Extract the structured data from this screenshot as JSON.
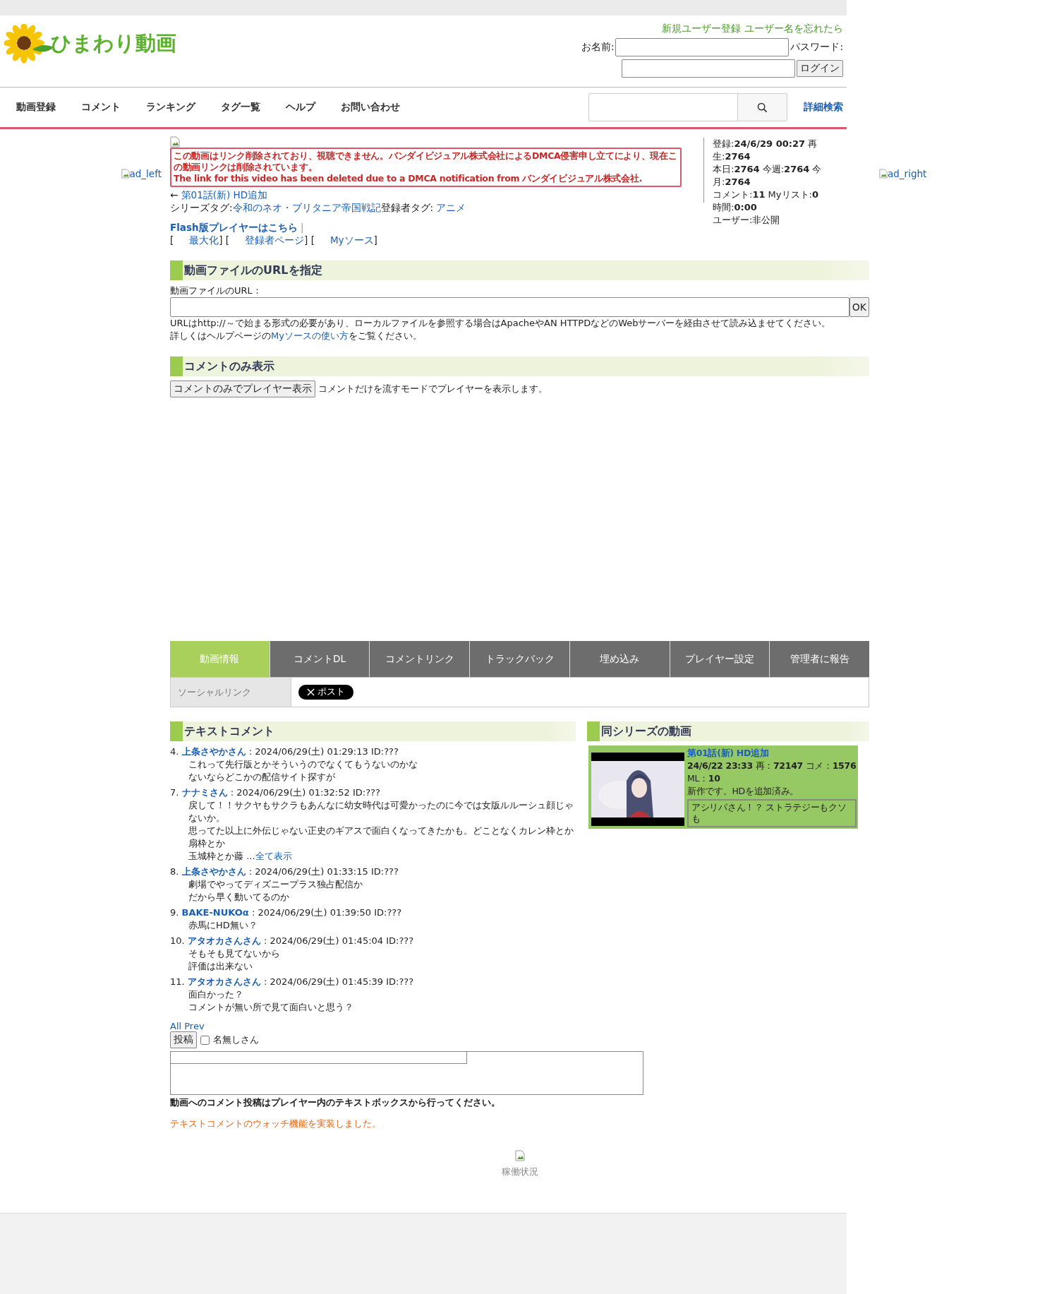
{
  "header": {
    "logo": "ひまわり動画",
    "links": [
      "新規ユーザー登録",
      "ユーザー名を忘れたら"
    ],
    "name_label": "お名前:",
    "password_label": "パスワード:",
    "login_button": "ログイン"
  },
  "nav": {
    "items": [
      "動画登録",
      "コメント",
      "ランキング",
      "タグ一覧",
      "ヘルプ",
      "お問い合わせ"
    ],
    "advanced_search": "詳細検索"
  },
  "ads": {
    "left": "ad_left",
    "right": "ad_right"
  },
  "notice": {
    "lines": [
      "この動画はリンク削除されており、視聴できません。バンダイビジュアル株式会社によるDMCA侵害申し立てにより、現在この動画リンクは削除されています。",
      "The link for this video has been deleted due to a DMCA notification from バンダイビジュアル株式会社."
    ]
  },
  "prev_link": {
    "arrow": "←",
    "title": "第01話(新) HD追加"
  },
  "tags": {
    "series_label": "シリーズタグ:",
    "series": "令和のネオ・ブリタニア帝国戦記",
    "user_label": "登録者タグ:",
    "user": "アニメ"
  },
  "player_links": {
    "flash": "Flash版プレイヤーはこちら",
    "separator": "|",
    "open": "[",
    "middle": "] [",
    "close": "]",
    "items": [
      "最大化",
      "登録者ページ",
      "Myソース"
    ]
  },
  "stats": {
    "lines": [
      [
        {
          "label": "登録:",
          "value": "24/6/29 00:27"
        },
        {
          "label": "再生:",
          "value": "2764"
        }
      ],
      [
        {
          "label": "本日:",
          "value": "2764"
        },
        {
          "label": "今週:",
          "value": "2764"
        },
        {
          "label": "今月:",
          "value": "2764"
        }
      ],
      [
        {
          "label": "コメント:",
          "value": "11"
        },
        {
          "label": "Myリスト:",
          "value": "0"
        }
      ],
      [
        {
          "label": "時間:",
          "value": "0:00"
        }
      ],
      [
        {
          "label": "ユーザー:非公開"
        }
      ]
    ]
  },
  "url_section": {
    "title": "動画ファイルのURLを指定",
    "label": "動画ファイルのURL：",
    "ok_button": "OK",
    "note": "URLはhttp://～で始まる形式の必要があり、ローカルファイルを参照する場合はApacheやAN HTTPDなどのWebサーバーを経由させて読み込ませてください。",
    "help_before": "詳しくはヘルプページの",
    "help_link": "Myソースの使い方",
    "help_after": "をご覧ください。"
  },
  "comment_only": {
    "title": "コメントのみ表示",
    "button": "コメントのみでプレイヤー表示",
    "note": "コメントだけを流すモードでプレイヤーを表示します。"
  },
  "tabs": [
    {
      "label": "動画情報",
      "selected": true
    },
    {
      "label": "コメントDL",
      "selected": false
    },
    {
      "label": "コメントリンク",
      "selected": false
    },
    {
      "label": "トラックバック",
      "selected": false
    },
    {
      "label": "埋め込み",
      "selected": false
    },
    {
      "label": "プレイヤー設定",
      "selected": false
    },
    {
      "label": "管理者に報告",
      "selected": false
    }
  ],
  "social": {
    "label": "ソーシャルリンク",
    "post_button": "ポスト"
  },
  "comments": {
    "title": "テキストコメント",
    "items": [
      {
        "number": "4.",
        "author": "上条さやかさん",
        "meta": ": 2024/06/29(土) 01:29:13 ID:???",
        "lines": [
          "これって先行版とかそういうのでなくてもうないのかな",
          "ないならどこかの配信サイト探すが"
        ]
      },
      {
        "number": "7.",
        "author": "ナナミさん",
        "meta": ": 2024/06/29(土) 01:32:52 ID:???",
        "lines": [
          "戻して！！サクヤもサクラもあんなに幼女時代は可愛かったのに今では女版ルルーシュ顔じゃないか。",
          "思ってた以上に外伝じゃない正史のギアスで面白くなってきたかも。どことなくカレン枠とか扇枠とか",
          "玉城枠とか藤 ..."
        ],
        "more": "全て表示"
      },
      {
        "number": "8.",
        "author": "上条さやかさん",
        "meta": ": 2024/06/29(土) 01:33:15 ID:???",
        "lines": [
          "劇場でやってディズニープラス独占配信か",
          "だから早く動いてるのか"
        ]
      },
      {
        "number": "9.",
        "author": "BAKE-NUKOα",
        "meta": ": 2024/06/29(土) 01:39:50 ID:???",
        "lines": [
          "赤馬にHD無い？"
        ]
      },
      {
        "number": "10.",
        "author": "アタオカさんさん",
        "meta": ": 2024/06/29(土) 01:45:04 ID:???",
        "lines": [
          "そもそも見てないから",
          "評価は出来ない"
        ]
      },
      {
        "number": "11.",
        "author": "アタオカさんさん",
        "meta": ": 2024/06/29(土) 01:45:39 ID:???",
        "lines": [
          "面白かった？",
          "コメントが無い所で見て面白いと思う？"
        ]
      }
    ],
    "all_prev": "All Prev",
    "post_button": "投稿",
    "anonymous": {
      "label": "名無しさん",
      "checked": false
    },
    "notice": "動画へのコメント投稿はプレイヤー内のテキストボックスから行ってください。",
    "watch_link": "テキストコメントのウォッチ機能を実装しました。"
  },
  "series": {
    "title": "同シリーズの動画",
    "videos": [
      {
        "title": "第01話(新) HD追加",
        "date": "24/6/22 23:33",
        "play_label": "再：",
        "plays": "72147",
        "comment_label": "コメ：",
        "comments": "1576",
        "ml_label": "ML：",
        "ml": "10",
        "description": "新作です。HDを追加済み。",
        "latest_comment": "アシリパさん！？ ストラテジーもクソも"
      }
    ]
  },
  "footer": {
    "status_link": "稼働状況"
  }
}
